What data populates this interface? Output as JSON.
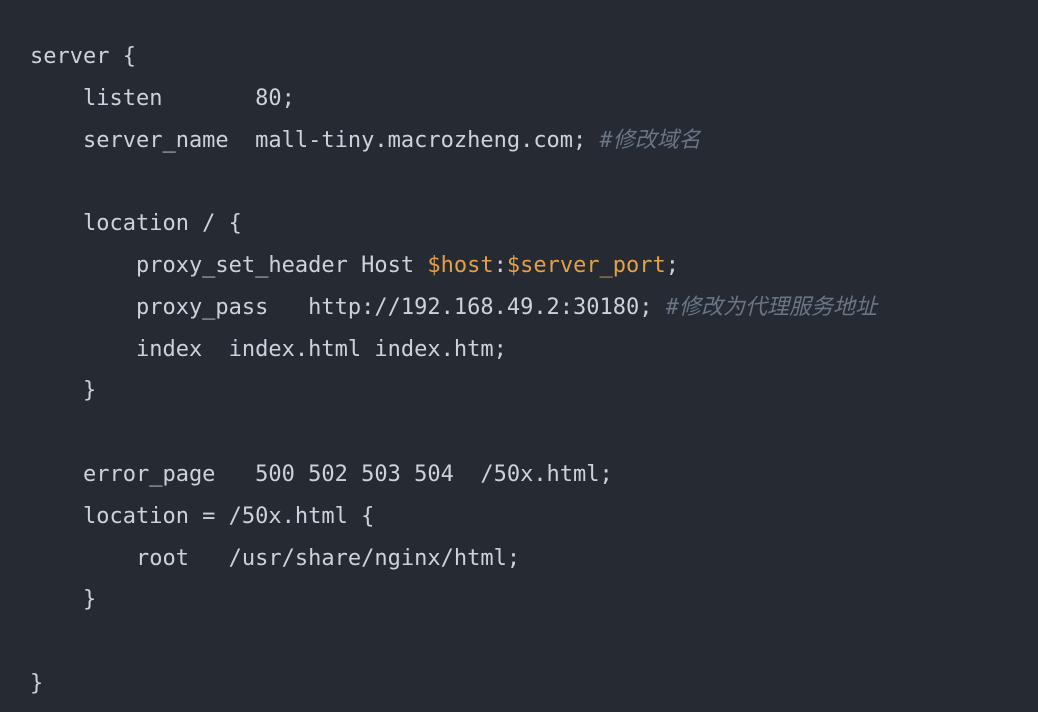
{
  "code": {
    "l1": "server {",
    "l2": "    listen       80;",
    "l3_a": "    server_name  mall-tiny.macrozheng.com; ",
    "l3_c": "#修改域名",
    "l4": "",
    "l5": "    location / {",
    "l6_a": "        proxy_set_header Host ",
    "l6_v1": "$host",
    "l6_b": ":",
    "l6_v2": "$server_port",
    "l6_c": ";",
    "l7_a": "        proxy_pass   http://192.168.49.2:30180; ",
    "l7_c": "#修改为代理服务地址",
    "l8": "        index  index.html index.htm;",
    "l9": "    }",
    "l10": "",
    "l11": "    error_page   500 502 503 504  /50x.html;",
    "l12": "    location = /50x.html {",
    "l13": "        root   /usr/share/nginx/html;",
    "l14": "    }",
    "l15": "",
    "l16": "}"
  }
}
